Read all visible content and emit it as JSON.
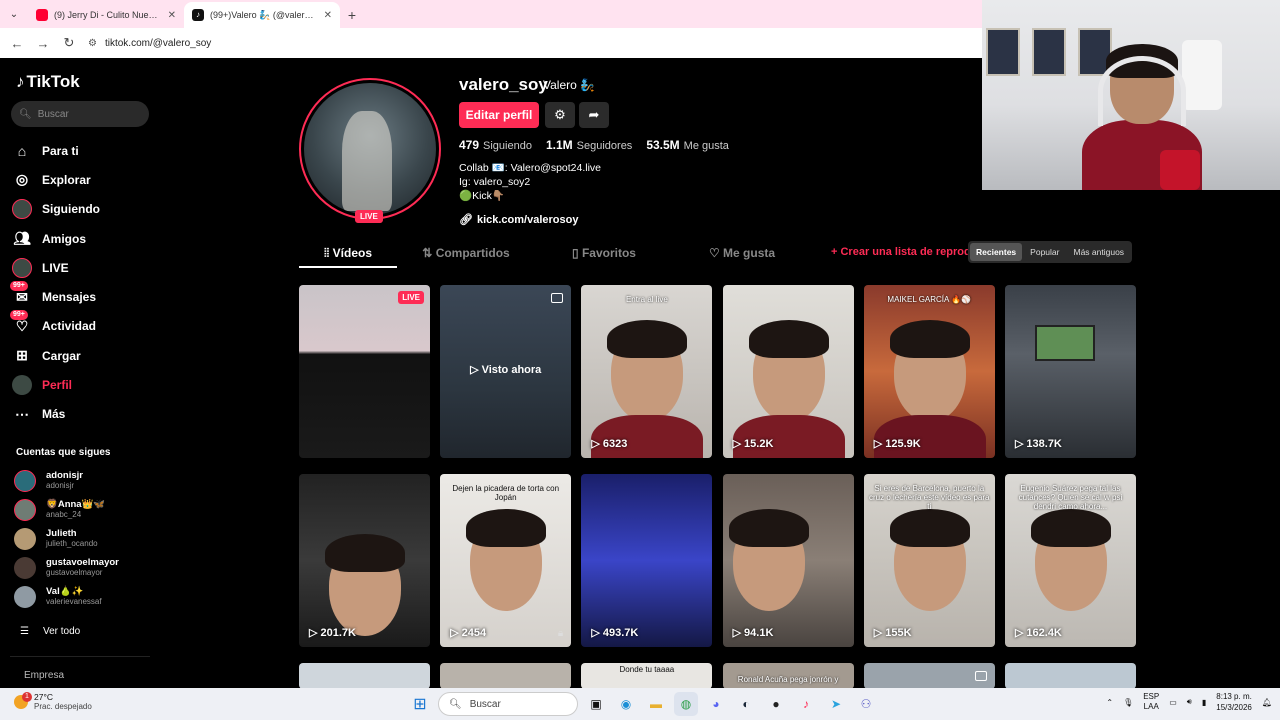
{
  "browser": {
    "tabs": [
      {
        "title": "(9) Jerry Di - Culito Nuevo 2 ft.",
        "active": false
      },
      {
        "title": "(99+)Valero 🧞 (@valero_soy) |",
        "active": true
      }
    ],
    "url": "tiktok.com/@valero_soy"
  },
  "sidebar": {
    "logo": "TikTok",
    "search_placeholder": "Buscar",
    "nav": [
      {
        "label": "Para ti",
        "icon": "home-icon"
      },
      {
        "label": "Explorar",
        "icon": "compass-icon"
      },
      {
        "label": "Siguiendo",
        "icon": "avatar-icon"
      },
      {
        "label": "Amigos",
        "icon": "friends-icon"
      },
      {
        "label": "LIVE",
        "icon": "live-icon"
      },
      {
        "label": "Mensajes",
        "icon": "messages-icon",
        "badge": "99+"
      },
      {
        "label": "Actividad",
        "icon": "activity-icon",
        "badge": "99+"
      },
      {
        "label": "Cargar",
        "icon": "upload-icon"
      },
      {
        "label": "Perfil",
        "icon": "profile-icon",
        "active": true
      },
      {
        "label": "Más",
        "icon": "more-icon"
      }
    ],
    "following_title": "Cuentas que sigues",
    "following": [
      {
        "name": "adonisjr",
        "handle": "adonisjr"
      },
      {
        "name": "🦁Anna👑🦋",
        "handle": "anabc_24"
      },
      {
        "name": "Julieth",
        "handle": "julieth_ocando"
      },
      {
        "name": "gustavoelmayor",
        "handle": "gustavoelmayor"
      },
      {
        "name": "Val🍐✨",
        "handle": "valerievanessaf"
      }
    ],
    "see_all": "Ver todo",
    "company": "Empresa"
  },
  "profile": {
    "username": "valero_soy",
    "nickname": "Valero 🧞",
    "live_tag": "LIVE",
    "edit_button": "Editar perfil",
    "stats": {
      "following_count": "479",
      "following_label": "Siguiendo",
      "followers_count": "1.1M",
      "followers_label": "Seguidores",
      "likes_count": "53.5M",
      "likes_label": "Me gusta"
    },
    "bio_line1": "Collab 📧: Valero@spot24.live",
    "bio_line2": "Ig: valero_soy2",
    "bio_line3": "🟢Kick👇🏽",
    "link": "kick.com/valerosoy"
  },
  "tabs": {
    "videos": "Vídeos",
    "reposts": "Compartidos",
    "favorites": "Favoritos",
    "liked": "Me gusta",
    "create_list": "+ Crear una lista de reproducción",
    "sort": [
      "Recientes",
      "Popular",
      "Más antiguos"
    ]
  },
  "videos": [
    {
      "views": "",
      "live": "LIVE",
      "type": "live"
    },
    {
      "views": "",
      "watched": "Visto ahora",
      "type": "watched"
    },
    {
      "views": "6323",
      "caption": "Entra al live"
    },
    {
      "views": "15.2K",
      "caption": ""
    },
    {
      "views": "125.9K",
      "caption": "MAIKEL GARCÍA 🔥⚾"
    },
    {
      "views": "138.7K",
      "caption": ""
    },
    {
      "views": "201.7K",
      "caption": ""
    },
    {
      "views": "2454",
      "caption": "Dejen la picadera de torta con Jopán",
      "locked": true
    },
    {
      "views": "493.7K",
      "caption": ""
    },
    {
      "views": "94.1K",
      "caption": ""
    },
    {
      "views": "155K",
      "caption": "Si eres de Barcelona, puerto la cruz o lechería este vídeo es para ti"
    },
    {
      "views": "162.4K",
      "caption": "Eugenio Suárez pega tal las cutances? Quien se cal w psi dendri camo ahora..."
    },
    {
      "caption": ""
    },
    {
      "caption": ""
    },
    {
      "caption": "Donde tu taaaa"
    },
    {
      "caption": "Ronald Acuña pega jonrón y"
    },
    {
      "caption": ""
    },
    {
      "caption": ""
    }
  ],
  "taskbar": {
    "temp": "27°C",
    "weather": "Prac. despejado",
    "weather_badge": "1",
    "search": "Buscar",
    "lang1": "ESP",
    "lang2": "LAA",
    "time": "8:13 p. m.",
    "date": "15/3/2026"
  },
  "colors": {
    "accent": "#fe2c55",
    "background": "#000000"
  }
}
